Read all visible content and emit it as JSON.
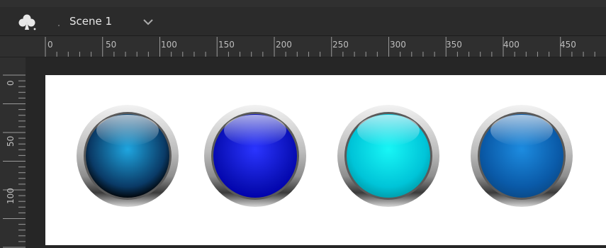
{
  "scene": {
    "title": "Scene 1",
    "icon": "club-icon",
    "dropdown_icon": "chevron-down-icon"
  },
  "ruler": {
    "horizontal_labels": [
      "0",
      "50",
      "100",
      "150",
      "200",
      "250",
      "300",
      "350",
      "400",
      "450"
    ],
    "vertical_labels": [
      "0",
      "50",
      "100"
    ]
  },
  "buttons": [
    {
      "name": "orb-button-dark-blue",
      "color_light": "#1fa6e0",
      "color_dark": "#0a3a66",
      "edge": "#000000"
    },
    {
      "name": "orb-button-blue",
      "color_light": "#2b35ff",
      "color_dark": "#0a10b8",
      "edge": "#0000aa"
    },
    {
      "name": "orb-button-cyan",
      "color_light": "#18f6f6",
      "color_dark": "#00c4d8",
      "edge": "#009aa8"
    },
    {
      "name": "orb-button-steel-blue",
      "color_light": "#1d8ce0",
      "color_dark": "#0a5aa8",
      "edge": "#0a4a88"
    }
  ]
}
